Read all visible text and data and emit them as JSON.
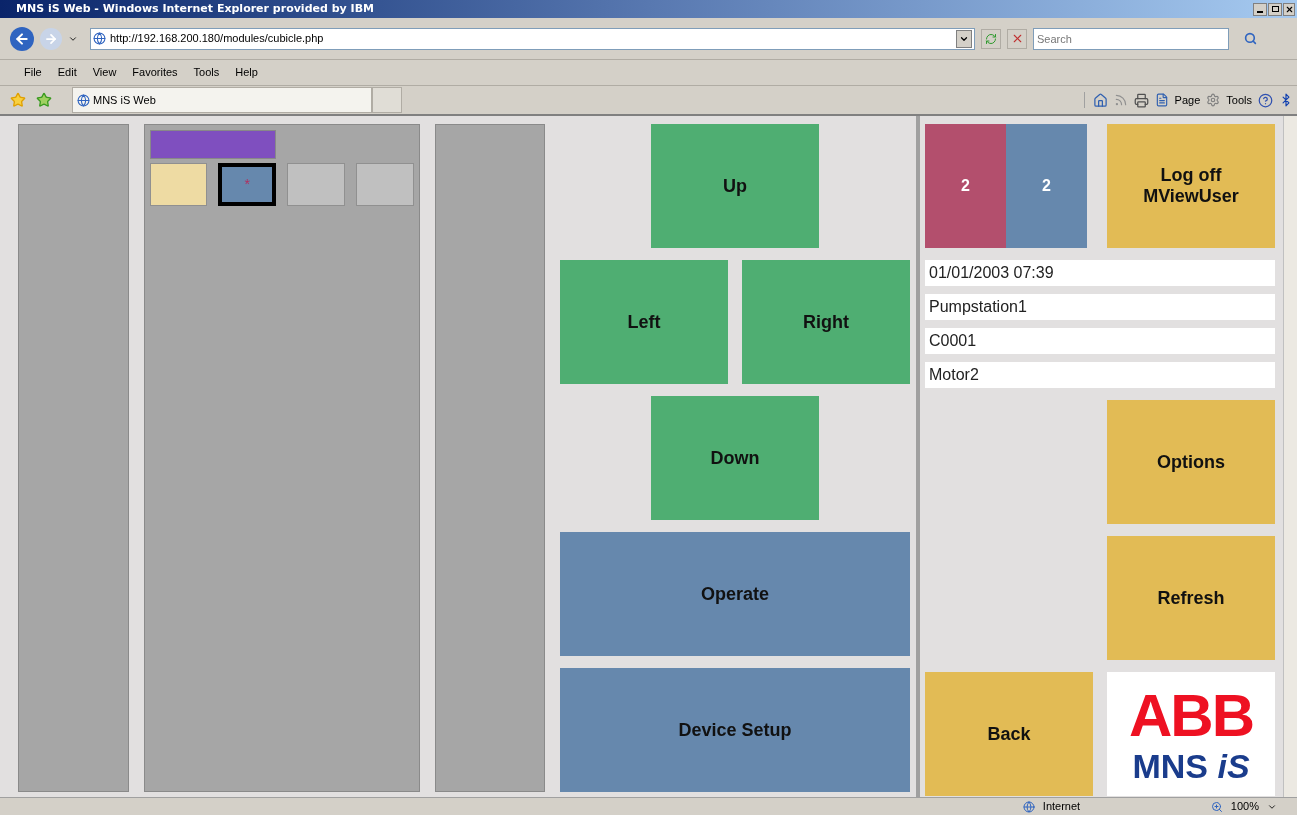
{
  "window": {
    "title": "MNS iS Web - Windows Internet Explorer provided by IBM"
  },
  "address_bar": {
    "url": "http://192.168.200.180/modules/cubicle.php"
  },
  "search": {
    "placeholder": "Search"
  },
  "menu": [
    "File",
    "Edit",
    "View",
    "Favorites",
    "Tools",
    "Help"
  ],
  "tab": {
    "label": "MNS iS Web"
  },
  "command_bar": [
    "Page",
    "Tools"
  ],
  "cubicle": {
    "header": {
      "color": "#7f4fbf"
    },
    "modules": [
      {
        "color": "#eedba3",
        "selected": false
      },
      {
        "color": "#6688ad",
        "selected": true,
        "marker": "*"
      },
      {
        "color": "#c0c0c0",
        "selected": false
      },
      {
        "color": "#c0c0c0",
        "selected": false
      }
    ]
  },
  "navigation": {
    "up": "Up",
    "left": "Left",
    "right": "Right",
    "down": "Down",
    "operate": "Operate",
    "device_setup": "Device Setup"
  },
  "counters": [
    {
      "value": "2",
      "color": "#b34f6d"
    },
    {
      "value": "2",
      "color": "#6688ad"
    }
  ],
  "log_off": [
    "Log off",
    "MViewUser"
  ],
  "info": [
    "01/01/2003 07:39",
    "Pumpstation1",
    "C0001",
    "Motor2"
  ],
  "options": "Options",
  "refresh": "Refresh",
  "back": "Back",
  "logo": {
    "brand": "ABB",
    "product": "MNS",
    "suffix": "iS"
  },
  "status_bar": {
    "zone": "Internet",
    "zoom": "100%"
  }
}
